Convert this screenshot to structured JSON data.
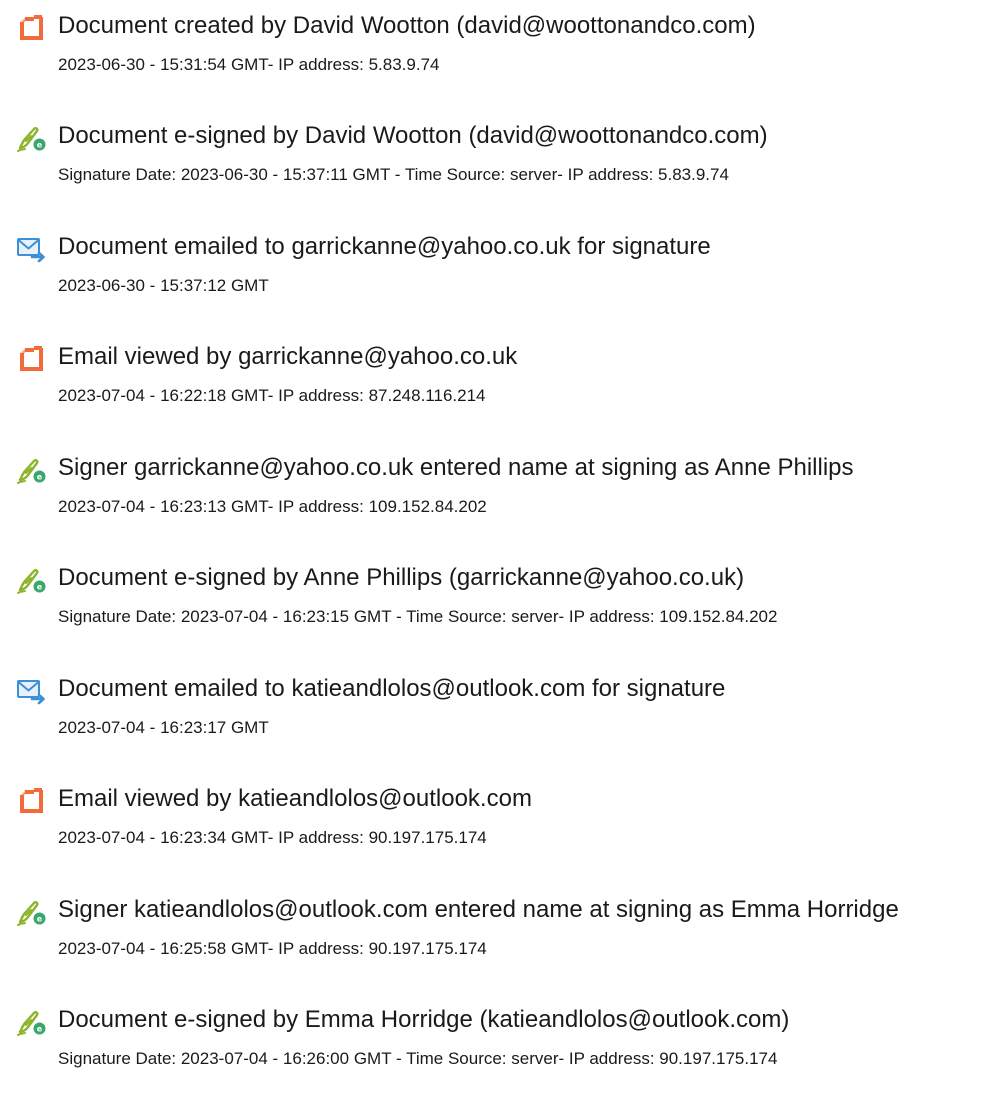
{
  "events": [
    {
      "icon": "document-created-icon",
      "title": "Document created by David Wootton (david@woottonandco.com)",
      "detail": "2023-06-30 - 15:31:54 GMT- IP address: 5.83.9.74"
    },
    {
      "icon": "e-signature-icon",
      "title": "Document e-signed by David Wootton (david@woottonandco.com)",
      "detail": "Signature Date: 2023-06-30 - 15:37:11 GMT - Time Source: server- IP address: 5.83.9.74"
    },
    {
      "icon": "email-sent-icon",
      "title": "Document emailed to garrickanne@yahoo.co.uk for signature",
      "detail": "2023-06-30 - 15:37:12 GMT"
    },
    {
      "icon": "email-viewed-icon",
      "title": "Email viewed by garrickanne@yahoo.co.uk",
      "detail": "2023-07-04 - 16:22:18 GMT- IP address: 87.248.116.214"
    },
    {
      "icon": "e-signature-icon",
      "title": "Signer garrickanne@yahoo.co.uk entered name at signing as Anne Phillips",
      "detail": "2023-07-04 - 16:23:13 GMT- IP address: 109.152.84.202"
    },
    {
      "icon": "e-signature-icon",
      "title": "Document e-signed by Anne Phillips (garrickanne@yahoo.co.uk)",
      "detail": "Signature Date: 2023-07-04 - 16:23:15 GMT - Time Source: server- IP address: 109.152.84.202"
    },
    {
      "icon": "email-sent-icon",
      "title": "Document emailed to katieandlolos@outlook.com for signature",
      "detail": "2023-07-04 - 16:23:17 GMT"
    },
    {
      "icon": "email-viewed-icon",
      "title": "Email viewed by katieandlolos@outlook.com",
      "detail": "2023-07-04 - 16:23:34 GMT- IP address: 90.197.175.174"
    },
    {
      "icon": "e-signature-icon",
      "title": "Signer katieandlolos@outlook.com entered name at signing as Emma Horridge",
      "detail": "2023-07-04 - 16:25:58 GMT- IP address: 90.197.175.174"
    },
    {
      "icon": "e-signature-icon",
      "title": "Document e-signed by Emma Horridge (katieandlolos@outlook.com)",
      "detail": "Signature Date: 2023-07-04 - 16:26:00 GMT - Time Source: server- IP address: 90.197.175.174"
    }
  ],
  "colors": {
    "document_icon": "#f26b3a",
    "signature_pen": "#8cb32a",
    "signature_badge": "#3aa76d",
    "email_icon": "#3d8fd6",
    "text": "#1a1a1a"
  }
}
